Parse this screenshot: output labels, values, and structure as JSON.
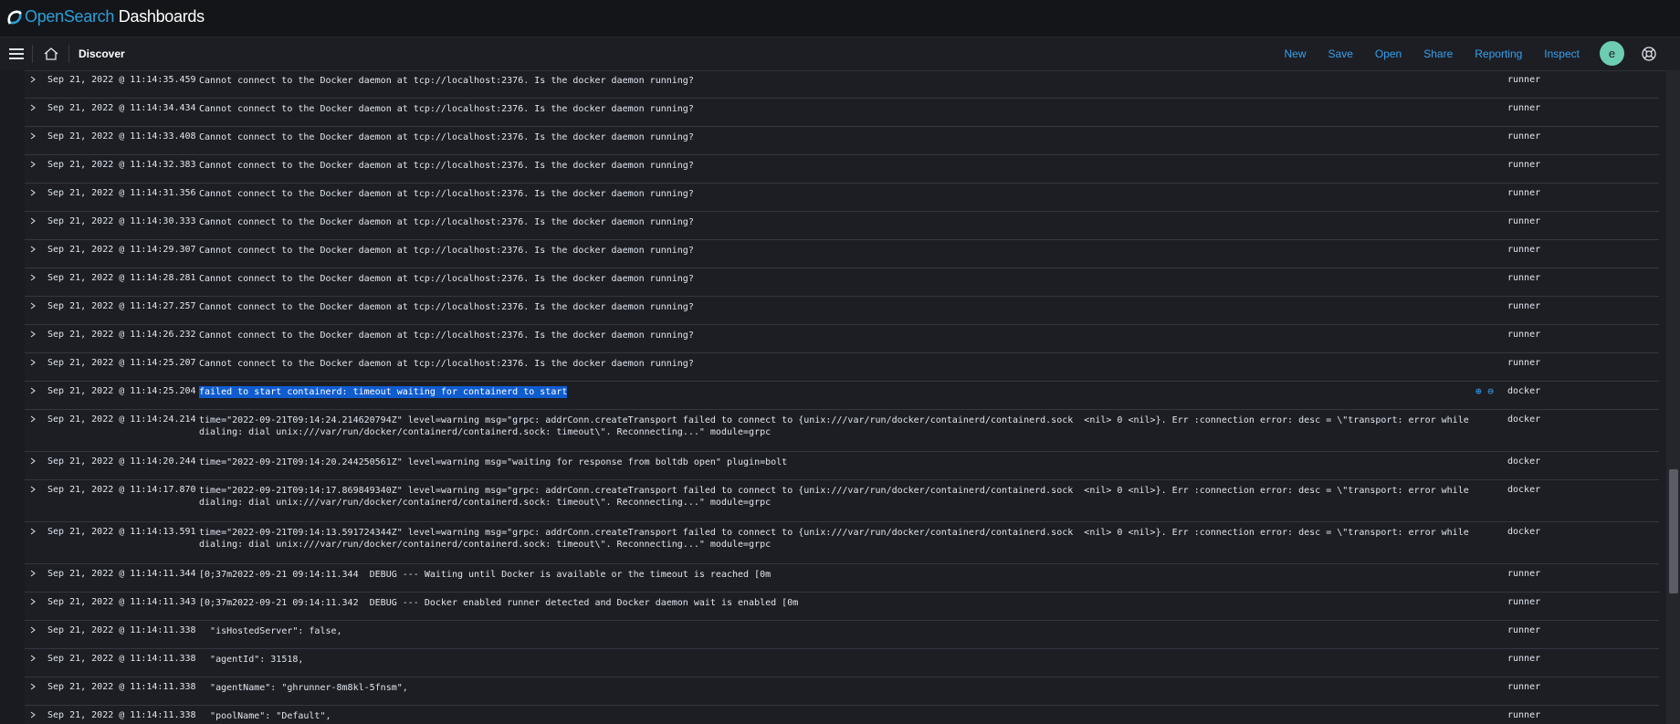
{
  "brand": {
    "name_prefix": "Open",
    "name_middle": "Search",
    "name_suffix": " Dashboards"
  },
  "nav": {
    "title": "Discover",
    "links": [
      "New",
      "Save",
      "Open",
      "Share",
      "Reporting",
      "Inspect"
    ],
    "avatar": "e"
  },
  "rows": [
    {
      "time": "Sep 21, 2022 @ 11:14:35.459",
      "message": "Cannot connect to the Docker daemon at tcp://localhost:2376. Is the docker daemon running?",
      "host": "runner"
    },
    {
      "time": "Sep 21, 2022 @ 11:14:34.434",
      "message": "Cannot connect to the Docker daemon at tcp://localhost:2376. Is the docker daemon running?",
      "host": "runner"
    },
    {
      "time": "Sep 21, 2022 @ 11:14:33.408",
      "message": "Cannot connect to the Docker daemon at tcp://localhost:2376. Is the docker daemon running?",
      "host": "runner"
    },
    {
      "time": "Sep 21, 2022 @ 11:14:32.383",
      "message": "Cannot connect to the Docker daemon at tcp://localhost:2376. Is the docker daemon running?",
      "host": "runner"
    },
    {
      "time": "Sep 21, 2022 @ 11:14:31.356",
      "message": "Cannot connect to the Docker daemon at tcp://localhost:2376. Is the docker daemon running?",
      "host": "runner"
    },
    {
      "time": "Sep 21, 2022 @ 11:14:30.333",
      "message": "Cannot connect to the Docker daemon at tcp://localhost:2376. Is the docker daemon running?",
      "host": "runner"
    },
    {
      "time": "Sep 21, 2022 @ 11:14:29.307",
      "message": "Cannot connect to the Docker daemon at tcp://localhost:2376. Is the docker daemon running?",
      "host": "runner"
    },
    {
      "time": "Sep 21, 2022 @ 11:14:28.281",
      "message": "Cannot connect to the Docker daemon at tcp://localhost:2376. Is the docker daemon running?",
      "host": "runner"
    },
    {
      "time": "Sep 21, 2022 @ 11:14:27.257",
      "message": "Cannot connect to the Docker daemon at tcp://localhost:2376. Is the docker daemon running?",
      "host": "runner"
    },
    {
      "time": "Sep 21, 2022 @ 11:14:26.232",
      "message": "Cannot connect to the Docker daemon at tcp://localhost:2376. Is the docker daemon running?",
      "host": "runner"
    },
    {
      "time": "Sep 21, 2022 @ 11:14:25.207",
      "message": "Cannot connect to the Docker daemon at tcp://localhost:2376. Is the docker daemon running?",
      "host": "runner"
    },
    {
      "time": "Sep 21, 2022 @ 11:14:25.204",
      "message": "failed to start containerd: timeout waiting for containerd to start",
      "host": "docker",
      "highlight": true
    },
    {
      "time": "Sep 21, 2022 @ 11:14:24.214",
      "message": "time=\"2022-09-21T09:14:24.214620794Z\" level=warning msg=\"grpc: addrConn.createTransport failed to connect to {unix:///var/run/docker/containerd/containerd.sock  <nil> 0 <nil>}. Err :connection error: desc = \\\"transport: error while dialing: dial unix:///var/run/docker/containerd/containerd.sock: timeout\\\". Reconnecting...\" module=grpc",
      "host": "docker",
      "tall": true
    },
    {
      "time": "Sep 21, 2022 @ 11:14:20.244",
      "message": "time=\"2022-09-21T09:14:20.244250561Z\" level=warning msg=\"waiting for response from boltdb open\" plugin=bolt",
      "host": "docker"
    },
    {
      "time": "Sep 21, 2022 @ 11:14:17.870",
      "message": "time=\"2022-09-21T09:14:17.869849340Z\" level=warning msg=\"grpc: addrConn.createTransport failed to connect to {unix:///var/run/docker/containerd/containerd.sock  <nil> 0 <nil>}. Err :connection error: desc = \\\"transport: error while dialing: dial unix:///var/run/docker/containerd/containerd.sock: timeout\\\". Reconnecting...\" module=grpc",
      "host": "docker",
      "tall": true
    },
    {
      "time": "Sep 21, 2022 @ 11:14:13.591",
      "message": "time=\"2022-09-21T09:14:13.591724344Z\" level=warning msg=\"grpc: addrConn.createTransport failed to connect to {unix:///var/run/docker/containerd/containerd.sock  <nil> 0 <nil>}. Err :connection error: desc = \\\"transport: error while dialing: dial unix:///var/run/docker/containerd/containerd.sock: timeout\\\". Reconnecting...\" module=grpc",
      "host": "docker",
      "tall": true
    },
    {
      "time": "Sep 21, 2022 @ 11:14:11.344",
      "message": "[0;37m2022-09-21 09:14:11.344  DEBUG --- Waiting until Docker is available or the timeout is reached [0m",
      "host": "runner"
    },
    {
      "time": "Sep 21, 2022 @ 11:14:11.343",
      "message": "[0;37m2022-09-21 09:14:11.342  DEBUG --- Docker enabled runner detected and Docker daemon wait is enabled [0m",
      "host": "runner"
    },
    {
      "time": "Sep 21, 2022 @ 11:14:11.338",
      "message": "  \"isHostedServer\": false,",
      "host": "runner"
    },
    {
      "time": "Sep 21, 2022 @ 11:14:11.338",
      "message": "  \"agentId\": 31518,",
      "host": "runner"
    },
    {
      "time": "Sep 21, 2022 @ 11:14:11.338",
      "message": "  \"agentName\": \"ghrunner-8m8kl-5fnsm\",",
      "host": "runner"
    },
    {
      "time": "Sep 21, 2022 @ 11:14:11.338",
      "message": "  \"poolName\": \"Default\",",
      "host": "runner"
    }
  ],
  "colors": {
    "background": "#1d1e24",
    "link": "#36a2ef",
    "highlight": "#0f5ccf",
    "avatar": "#6dccb1"
  }
}
